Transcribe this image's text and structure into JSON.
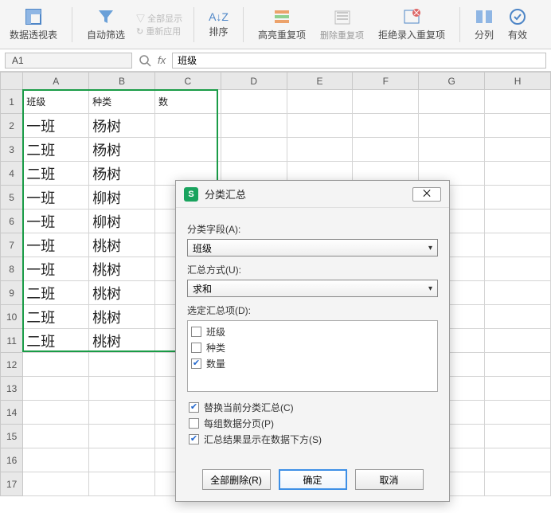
{
  "ribbon": {
    "pivot": "数据透视表",
    "autofilter": "自动筛选",
    "showall": "全部显示",
    "reapply": "重新应用",
    "sort_icon": "A↓Z",
    "sort": "排序",
    "highlight": "高亮重复项",
    "dedup": "删除重复项",
    "reject": "拒绝录入重复项",
    "textcol": "分列",
    "valid": "有效"
  },
  "namebox": {
    "cell": "A1"
  },
  "formula": {
    "fx": "fx",
    "value": "班级"
  },
  "columns": [
    "A",
    "B",
    "C",
    "D",
    "E",
    "F",
    "G",
    "H"
  ],
  "rows_count": 17,
  "header_row": {
    "a": "班级",
    "b": "种类",
    "c": "数"
  },
  "data_rows": [
    {
      "a": "一班",
      "b": "杨树"
    },
    {
      "a": "二班",
      "b": "杨树"
    },
    {
      "a": "二班",
      "b": "杨树"
    },
    {
      "a": "一班",
      "b": "柳树"
    },
    {
      "a": "一班",
      "b": "柳树"
    },
    {
      "a": "一班",
      "b": "桃树"
    },
    {
      "a": "一班",
      "b": "桃树"
    },
    {
      "a": "二班",
      "b": "桃树"
    },
    {
      "a": "二班",
      "b": "桃树"
    },
    {
      "a": "二班",
      "b": "桃树"
    }
  ],
  "dialog": {
    "title": "分类汇总",
    "close": "⨉",
    "field_label": "分类字段(A):",
    "field_value": "班级",
    "method_label": "汇总方式(U):",
    "method_value": "求和",
    "items_label": "选定汇总项(D):",
    "items": [
      {
        "label": "班级",
        "checked": false
      },
      {
        "label": "种类",
        "checked": false
      },
      {
        "label": "数量",
        "checked": true
      }
    ],
    "opt_replace": {
      "label": "替换当前分类汇总(C)",
      "checked": true
    },
    "opt_page": {
      "label": "每组数据分页(P)",
      "checked": false
    },
    "opt_below": {
      "label": "汇总结果显示在数据下方(S)",
      "checked": true
    },
    "btn_delete": "全部删除(R)",
    "btn_ok": "确定",
    "btn_cancel": "取消"
  }
}
